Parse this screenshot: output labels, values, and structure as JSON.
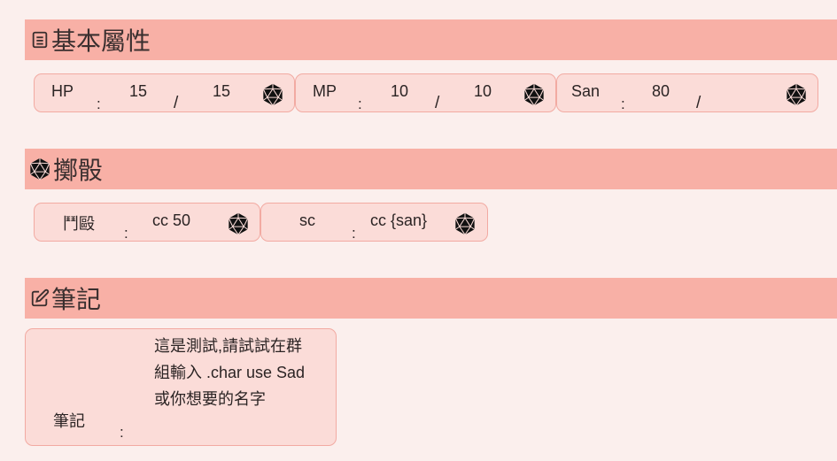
{
  "sections": {
    "basic": {
      "title": "基本屬性",
      "icon": "list-icon"
    },
    "roll": {
      "title": "擲骰",
      "icon": "d20-icon"
    },
    "notes": {
      "title": "筆記",
      "icon": "edit-icon"
    }
  },
  "attributes": [
    {
      "label": "HP",
      "colon": ":",
      "current": "15",
      "slash": "/",
      "max": "15",
      "icon": "d20-icon"
    },
    {
      "label": "MP",
      "colon": ":",
      "current": "10",
      "slash": "/",
      "max": "10",
      "icon": "d20-icon"
    },
    {
      "label": "San",
      "colon": ":",
      "current": "80",
      "slash": "/",
      "max": "",
      "icon": "d20-icon"
    }
  ],
  "rolls": [
    {
      "label": "鬥毆",
      "colon": ":",
      "command": "cc 50",
      "icon": "d20-icon"
    },
    {
      "label": "sc",
      "colon": ":",
      "command": "cc {san}",
      "icon": "d20-icon"
    }
  ],
  "notes": {
    "label": "筆記",
    "colon": ":",
    "lines": [
      "這是測試,請試試在群",
      "組輸入 .char use Sad",
      "或你想要的名字"
    ]
  },
  "colors": {
    "background": "#fbefed",
    "header": "#f8b0a6",
    "card": "#fbdcd8",
    "card_border": "#f2aaa2"
  }
}
